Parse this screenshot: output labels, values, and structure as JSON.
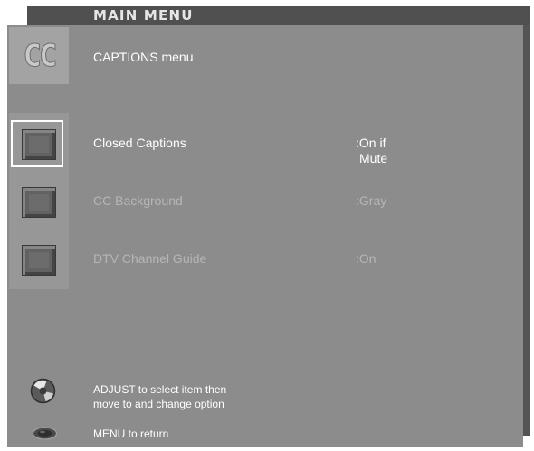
{
  "header": {
    "title": "MAIN MENU"
  },
  "submenu": {
    "icon": "cc-icon",
    "icon_text": "CC",
    "title": "CAPTIONS menu"
  },
  "items": [
    {
      "icon": "square-button-icon",
      "label": "Closed Captions",
      "value_line1": ":On if",
      "value_line2": "Mute",
      "selected": true
    },
    {
      "icon": "square-button-icon",
      "label": "CC Background",
      "value_line1": ":Gray",
      "selected": false
    },
    {
      "icon": "square-button-icon",
      "label": "DTV Channel Guide",
      "value_line1": ":On",
      "selected": false
    }
  ],
  "help": {
    "adjust_icon": "knob-icon",
    "adjust_line1": "ADJUST to select item then",
    "adjust_line2": "move to and change option",
    "menu_icon": "menu-button-icon",
    "menu_text": "MENU to return"
  },
  "colors": {
    "panel": "#8c8c8c",
    "title_bar": "#505050",
    "icon_cell": "#979797",
    "cc_cell": "#a3a3a3",
    "text_active": "#ffffff",
    "text_dim": "#b6b6b6",
    "selection": "#ffffff"
  }
}
